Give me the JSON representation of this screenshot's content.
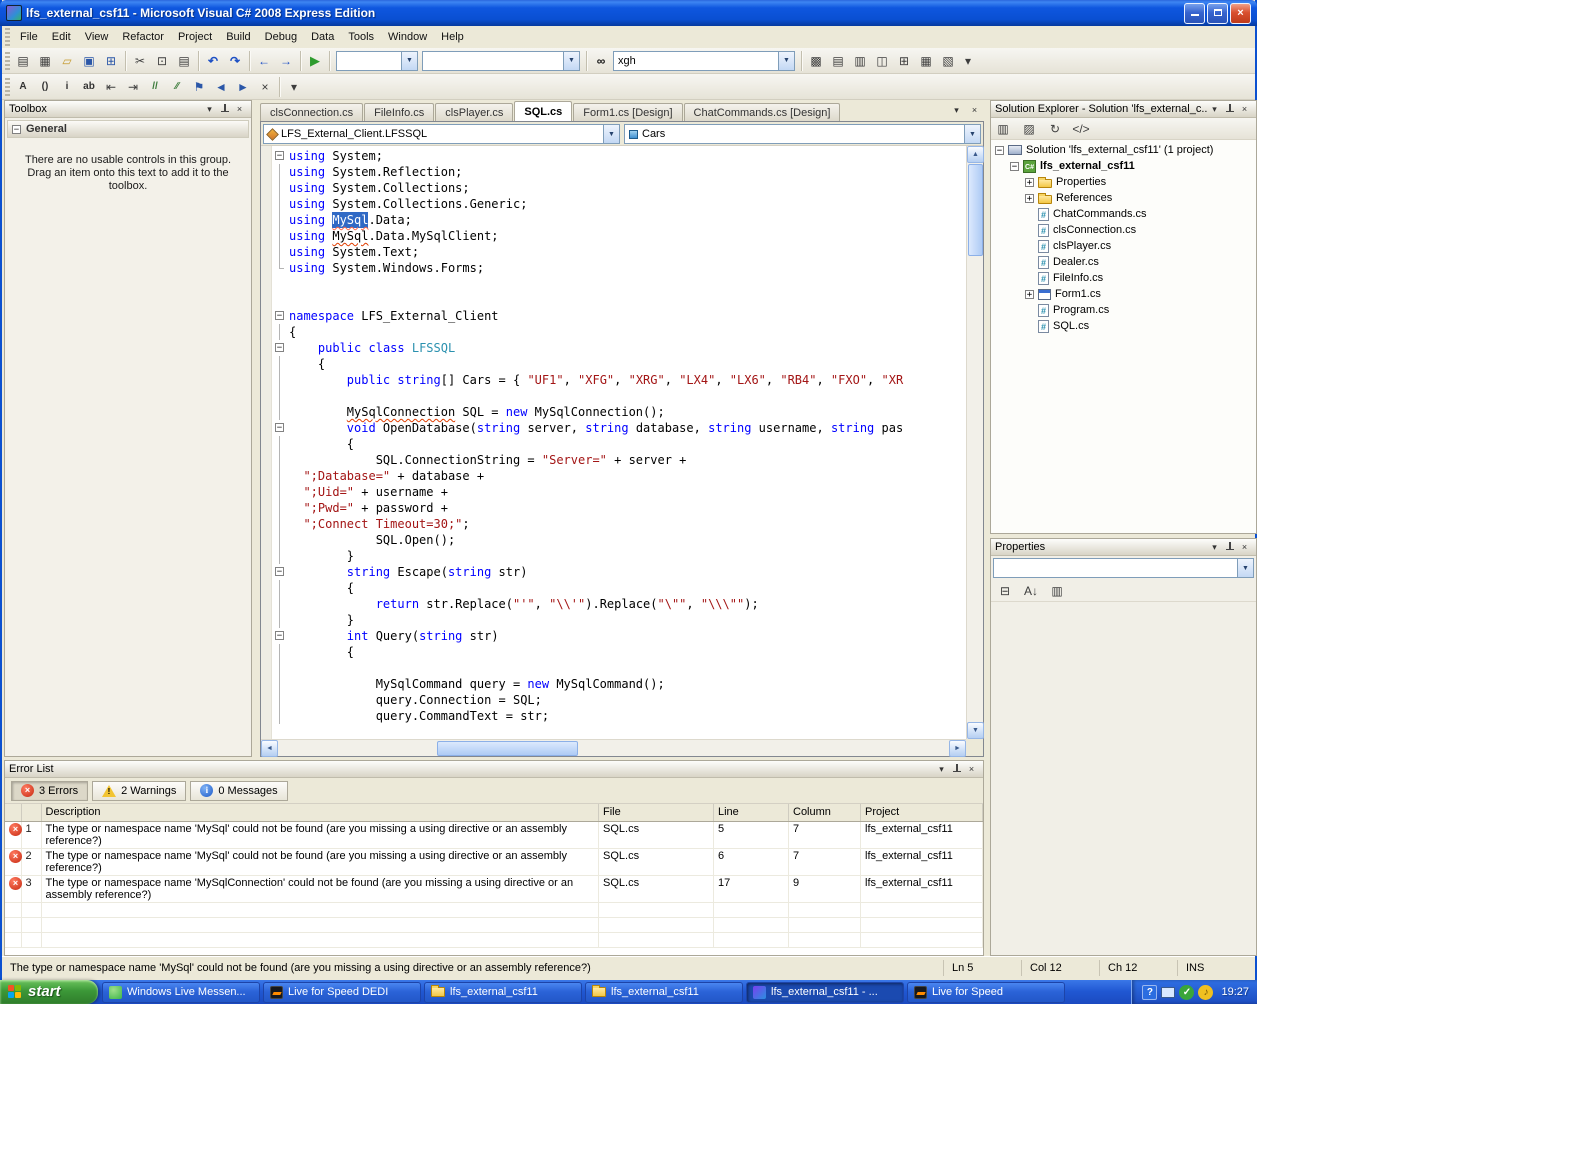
{
  "window": {
    "title": "lfs_external_csf11 - Microsoft Visual C# 2008 Express Edition"
  },
  "menu": {
    "items": [
      "File",
      "Edit",
      "View",
      "Refactor",
      "Project",
      "Build",
      "Debug",
      "Data",
      "Tools",
      "Window",
      "Help"
    ]
  },
  "toolbar": {
    "find_value": "xgh",
    "icons_std": [
      "new-project",
      "add-new-item",
      "open-file",
      "save-file",
      "save-all"
    ],
    "icons_clipboard": [
      "cut",
      "copy",
      "paste"
    ],
    "icons_undo": [
      "undo",
      "redo"
    ],
    "icons_nav": [
      "navigate-backward",
      "navigate-forward"
    ],
    "icons_debug": [
      "start-debugging"
    ],
    "icons_windows": [
      "find-in-files",
      "solution-explorer-window",
      "properties-window",
      "object-browser",
      "toolbox-window",
      "error-list-window",
      "output-window"
    ],
    "icons_text_editor": [
      "member-list",
      "parameter-info",
      "quick-info",
      "word-completion",
      "decrease-indent",
      "increase-indent",
      "comment-selection",
      "uncomment-selection",
      "toggle-bookmark",
      "previous-bookmark",
      "next-bookmark",
      "clear-bookmarks"
    ]
  },
  "toolbox": {
    "title": "Toolbox",
    "section": "General",
    "empty_text": "There are no usable controls in this group. Drag an item onto this text to add it to the toolbox."
  },
  "tabs": {
    "items": [
      {
        "label": "clsConnection.cs",
        "active": false
      },
      {
        "label": "FileInfo.cs",
        "active": false
      },
      {
        "label": "clsPlayer.cs",
        "active": false
      },
      {
        "label": "SQL.cs",
        "active": true
      },
      {
        "label": "Form1.cs [Design]",
        "active": false
      },
      {
        "label": "ChatCommands.cs [Design]",
        "active": false
      }
    ]
  },
  "editor": {
    "type_dropdown": "LFS_External_Client.LFSSQL",
    "member_dropdown": "Cars",
    "lines": [
      {
        "f": "b",
        "t": [
          [
            "kw",
            "using"
          ],
          [
            "pl",
            " System;"
          ]
        ]
      },
      {
        "f": "l",
        "t": [
          [
            "kw",
            "using"
          ],
          [
            "pl",
            " System.Reflection;"
          ]
        ]
      },
      {
        "f": "l",
        "t": [
          [
            "kw",
            "using"
          ],
          [
            "pl",
            " System.Collections;"
          ]
        ]
      },
      {
        "f": "l",
        "t": [
          [
            "kw",
            "using"
          ],
          [
            "pl",
            " System.Collections.Generic;"
          ]
        ]
      },
      {
        "f": "l",
        "t": [
          [
            "kw",
            "using"
          ],
          [
            "pl",
            " "
          ],
          [
            "sel",
            "MySql"
          ],
          [
            "pl",
            ".Data;"
          ]
        ]
      },
      {
        "f": "l",
        "t": [
          [
            "kw",
            "using"
          ],
          [
            "pl",
            " "
          ],
          [
            "err",
            "MySql"
          ],
          [
            "pl",
            ".Data.MySqlClient;"
          ]
        ]
      },
      {
        "f": "l",
        "t": [
          [
            "kw",
            "using"
          ],
          [
            "pl",
            " System.Text;"
          ]
        ]
      },
      {
        "f": "e",
        "t": [
          [
            "kw",
            "using"
          ],
          [
            "pl",
            " System.Windows.Forms;"
          ]
        ]
      },
      {
        "f": "",
        "t": []
      },
      {
        "f": "",
        "t": []
      },
      {
        "f": "b",
        "t": [
          [
            "kw",
            "namespace"
          ],
          [
            "pl",
            " LFS_External_Client"
          ]
        ]
      },
      {
        "f": "l",
        "t": [
          [
            "pl",
            "{"
          ]
        ]
      },
      {
        "f": "b",
        "t": [
          [
            "pl",
            "    "
          ],
          [
            "kw",
            "public"
          ],
          [
            "pl",
            " "
          ],
          [
            "kw",
            "class"
          ],
          [
            "pl",
            " "
          ],
          [
            "typ",
            "LFSSQL"
          ]
        ]
      },
      {
        "f": "l",
        "t": [
          [
            "pl",
            "    {"
          ]
        ]
      },
      {
        "f": "l",
        "t": [
          [
            "pl",
            "        "
          ],
          [
            "kw",
            "public"
          ],
          [
            "pl",
            " "
          ],
          [
            "kw",
            "string"
          ],
          [
            "pl",
            "[] Cars = { "
          ],
          [
            "str",
            "\"UF1\""
          ],
          [
            "pl",
            ", "
          ],
          [
            "str",
            "\"XFG\""
          ],
          [
            "pl",
            ", "
          ],
          [
            "str",
            "\"XRG\""
          ],
          [
            "pl",
            ", "
          ],
          [
            "str",
            "\"LX4\""
          ],
          [
            "pl",
            ", "
          ],
          [
            "str",
            "\"LX6\""
          ],
          [
            "pl",
            ", "
          ],
          [
            "str",
            "\"RB4\""
          ],
          [
            "pl",
            ", "
          ],
          [
            "str",
            "\"FXO\""
          ],
          [
            "pl",
            ", "
          ],
          [
            "str",
            "\"XR"
          ]
        ]
      },
      {
        "f": "l",
        "t": []
      },
      {
        "f": "l",
        "t": [
          [
            "pl",
            "        "
          ],
          [
            "err",
            "MySqlConnection"
          ],
          [
            "pl",
            " SQL = "
          ],
          [
            "kw",
            "new"
          ],
          [
            "pl",
            " MySqlConnection();"
          ]
        ]
      },
      {
        "f": "b",
        "t": [
          [
            "pl",
            "        "
          ],
          [
            "kw",
            "void"
          ],
          [
            "pl",
            " OpenDatabase("
          ],
          [
            "kw",
            "string"
          ],
          [
            "pl",
            " server, "
          ],
          [
            "kw",
            "string"
          ],
          [
            "pl",
            " database, "
          ],
          [
            "kw",
            "string"
          ],
          [
            "pl",
            " username, "
          ],
          [
            "kw",
            "string"
          ],
          [
            "pl",
            " pas"
          ]
        ]
      },
      {
        "f": "l",
        "t": [
          [
            "pl",
            "        {"
          ]
        ]
      },
      {
        "f": "l",
        "t": [
          [
            "pl",
            "            SQL.ConnectionString = "
          ],
          [
            "str",
            "\"Server=\""
          ],
          [
            "pl",
            " + server +"
          ]
        ]
      },
      {
        "f": "l",
        "t": [
          [
            "pl",
            "  "
          ],
          [
            "str",
            "\";Database=\""
          ],
          [
            "pl",
            " + database +"
          ]
        ]
      },
      {
        "f": "l",
        "t": [
          [
            "pl",
            "  "
          ],
          [
            "str",
            "\";Uid=\""
          ],
          [
            "pl",
            " + username +"
          ]
        ]
      },
      {
        "f": "l",
        "t": [
          [
            "pl",
            "  "
          ],
          [
            "str",
            "\";Pwd=\""
          ],
          [
            "pl",
            " + password +"
          ]
        ]
      },
      {
        "f": "l",
        "t": [
          [
            "pl",
            "  "
          ],
          [
            "str",
            "\";Connect Timeout=30;\""
          ],
          [
            "pl",
            ";"
          ]
        ]
      },
      {
        "f": "l",
        "t": [
          [
            "pl",
            "            SQL.Open();"
          ]
        ]
      },
      {
        "f": "l",
        "t": [
          [
            "pl",
            "        }"
          ]
        ]
      },
      {
        "f": "b",
        "t": [
          [
            "pl",
            "        "
          ],
          [
            "kw",
            "string"
          ],
          [
            "pl",
            " Escape("
          ],
          [
            "kw",
            "string"
          ],
          [
            "pl",
            " str)"
          ]
        ]
      },
      {
        "f": "l",
        "t": [
          [
            "pl",
            "        {"
          ]
        ]
      },
      {
        "f": "l",
        "t": [
          [
            "pl",
            "            "
          ],
          [
            "kw",
            "return"
          ],
          [
            "pl",
            " str.Replace("
          ],
          [
            "str",
            "\"'\""
          ],
          [
            "pl",
            ", "
          ],
          [
            "str",
            "\"\\\\'\""
          ],
          [
            "pl",
            ").Replace("
          ],
          [
            "str",
            "\"\\\"\""
          ],
          [
            "pl",
            ", "
          ],
          [
            "str",
            "\"\\\\\\\"\""
          ],
          [
            "pl",
            ");"
          ]
        ]
      },
      {
        "f": "l",
        "t": [
          [
            "pl",
            "        }"
          ]
        ]
      },
      {
        "f": "b",
        "t": [
          [
            "pl",
            "        "
          ],
          [
            "kw",
            "int"
          ],
          [
            "pl",
            " Query("
          ],
          [
            "kw",
            "string"
          ],
          [
            "pl",
            " str)"
          ]
        ]
      },
      {
        "f": "l",
        "t": [
          [
            "pl",
            "        {"
          ]
        ]
      },
      {
        "f": "l",
        "t": []
      },
      {
        "f": "l",
        "t": [
          [
            "pl",
            "            MySqlCommand query = "
          ],
          [
            "kw",
            "new"
          ],
          [
            "pl",
            " MySqlCommand();"
          ]
        ]
      },
      {
        "f": "l",
        "t": [
          [
            "pl",
            "            query.Connection = SQL;"
          ]
        ]
      },
      {
        "f": "l",
        "t": [
          [
            "pl",
            "            query.CommandText = str;"
          ]
        ]
      }
    ]
  },
  "solution_explorer": {
    "title": "Solution Explorer - Solution 'lfs_external_c...",
    "toolbar_icons": [
      "properties-window",
      "show-all-files",
      "refresh",
      "code-view"
    ],
    "items": [
      {
        "label": "Solution 'lfs_external_csf11' (1 project)",
        "level": 0,
        "icon": "solution",
        "expand": "minus",
        "bold": false
      },
      {
        "label": "lfs_external_csf11",
        "level": 1,
        "icon": "project",
        "expand": "minus",
        "bold": true
      },
      {
        "label": "Properties",
        "level": 2,
        "icon": "properties-folder",
        "expand": "plus",
        "bold": false
      },
      {
        "label": "References",
        "level": 2,
        "icon": "references-folder",
        "expand": "plus",
        "bold": false
      },
      {
        "label": "ChatCommands.cs",
        "level": 2,
        "icon": "cs-file",
        "expand": "",
        "bold": false
      },
      {
        "label": "clsConnection.cs",
        "level": 2,
        "icon": "cs-file",
        "expand": "",
        "bold": false
      },
      {
        "label": "clsPlayer.cs",
        "level": 2,
        "icon": "cs-file",
        "expand": "",
        "bold": false
      },
      {
        "label": "Dealer.cs",
        "level": 2,
        "icon": "cs-file",
        "expand": "",
        "bold": false
      },
      {
        "label": "FileInfo.cs",
        "level": 2,
        "icon": "cs-file",
        "expand": "",
        "bold": false
      },
      {
        "label": "Form1.cs",
        "level": 2,
        "icon": "form-file",
        "expand": "plus",
        "bold": false
      },
      {
        "label": "Program.cs",
        "level": 2,
        "icon": "cs-file",
        "expand": "",
        "bold": false
      },
      {
        "label": "SQL.cs",
        "level": 2,
        "icon": "cs-file",
        "expand": "",
        "bold": false
      }
    ]
  },
  "properties_panel": {
    "title": "Properties",
    "toolbar_icons": [
      "categorized",
      "alphabetical",
      "property-pages"
    ]
  },
  "error_list": {
    "title": "Error List",
    "filters": [
      {
        "label": "3 Errors",
        "type": "error",
        "pressed": true
      },
      {
        "label": "2 Warnings",
        "type": "warning",
        "pressed": false
      },
      {
        "label": "0 Messages",
        "type": "info",
        "pressed": false
      }
    ],
    "columns": [
      "",
      "",
      "Description",
      "File",
      "Line",
      "Column",
      "Project"
    ],
    "rows": [
      {
        "num": "1",
        "description": "The type or namespace name 'MySql' could not be found (are you missing a using directive or an assembly reference?)",
        "file": "SQL.cs",
        "line": "5",
        "column": "7",
        "project": "lfs_external_csf11"
      },
      {
        "num": "2",
        "description": "The type or namespace name 'MySql' could not be found (are you missing a using directive or an assembly reference?)",
        "file": "SQL.cs",
        "line": "6",
        "column": "7",
        "project": "lfs_external_csf11"
      },
      {
        "num": "3",
        "description": "The type or namespace name 'MySqlConnection' could not be found (are you missing a using directive or an assembly reference?)",
        "file": "SQL.cs",
        "line": "17",
        "column": "9",
        "project": "lfs_external_csf11"
      }
    ]
  },
  "status_bar": {
    "message": "The type or namespace name 'MySql' could not be found (are you missing a using directive or an assembly reference?)",
    "ln": "Ln 5",
    "col": "Col 12",
    "ch": "Ch 12",
    "mode": "INS"
  },
  "taskbar": {
    "start_label": "start",
    "items": [
      {
        "label": "Windows Live Messen...",
        "icon": "messenger",
        "active": false
      },
      {
        "label": "Live for Speed DEDI",
        "icon": "lfs",
        "active": false
      },
      {
        "label": "lfs_external_csf11",
        "icon": "folder",
        "active": false
      },
      {
        "label": "lfs_external_csf11",
        "icon": "folder",
        "active": false
      },
      {
        "label": "lfs_external_csf11 - ...",
        "icon": "visual-studio",
        "active": true
      },
      {
        "label": "Live for Speed",
        "icon": "lfs",
        "active": false
      }
    ],
    "clock": "19:27"
  }
}
